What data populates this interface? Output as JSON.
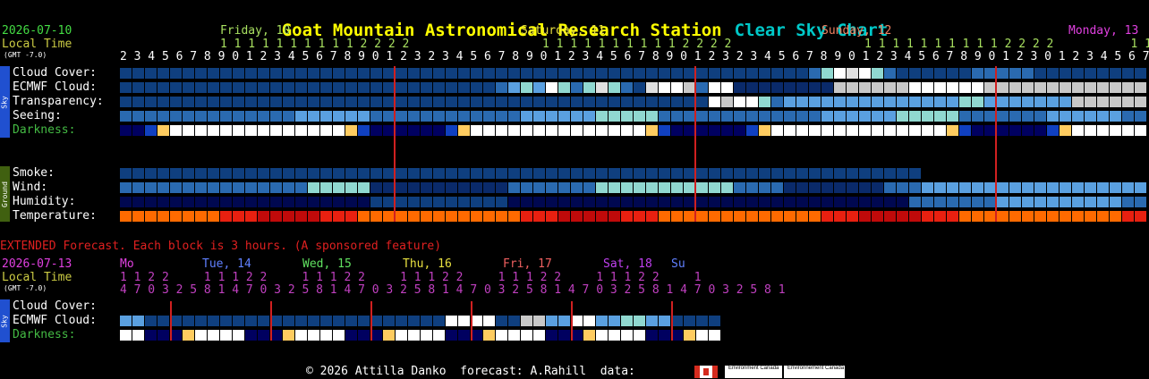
{
  "header": {
    "station": "Goat Mountain Astronomical Research Station",
    "chart_name": "Clear Sky Chart",
    "date": "2026-07-10",
    "local_time": "Local Time",
    "gmt_offset": "(GMT -7.0)"
  },
  "days": [
    {
      "label": "Friday, 10",
      "color": "#a8e060"
    },
    {
      "label": "Saturday, 11",
      "color": "#e8e040"
    },
    {
      "label": "Sunday, 12",
      "color": "#f08060"
    },
    {
      "label": "Monday, 13",
      "color": "#e040e0"
    }
  ],
  "hours_tens": " 1 1 1 1 1 1 1 1 1 1 2 2 2 2",
  "hours_units": "2 3 4 5 6 7 8 9 0 1 2 3 4 5 6 7 8 9 0 1 2 3",
  "monday_tens": "1 1",
  "monday_units": "0 1 2 3 4 5 6 7 8 9 0 1",
  "sky_rows": [
    {
      "label": "Cloud Cover:",
      "key": "cloud"
    },
    {
      "label": "ECMWF Cloud:",
      "key": "ecmwf"
    },
    {
      "label": "Transparency:",
      "key": "transp"
    },
    {
      "label": "Seeing:",
      "key": "seeing"
    },
    {
      "label": "Darkness:",
      "key": "dark"
    }
  ],
  "ground_rows": [
    {
      "label": "Smoke:",
      "key": "smoke"
    },
    {
      "label": "Wind:",
      "key": "wind"
    },
    {
      "label": "Humidity:",
      "key": "humid"
    },
    {
      "label": "Temperature:",
      "key": "temp"
    }
  ],
  "tabs": {
    "sky": "Sky",
    "ground": "Ground"
  },
  "extended": {
    "notice": "EXTENDED Forecast. Each block is 3 hours. (A sponsored feature)",
    "date": "2026-07-13",
    "local_time": "Local Time",
    "gmt_offset": "(GMT -7.0)",
    "days": [
      {
        "label": "Mo",
        "color": "#e040e0"
      },
      {
        "label": "Tue, 14",
        "color": "#6080ff"
      },
      {
        "label": "Wed, 15",
        "color": "#60e060"
      },
      {
        "label": "Thu, 16",
        "color": "#e8e040"
      },
      {
        "label": "Fri, 17",
        "color": "#f06060"
      },
      {
        "label": "Sat, 18",
        "color": "#c040f0"
      },
      {
        "label": "Su",
        "color": "#6080ff"
      }
    ],
    "hours_tens": "1 1 2 2     1 1 1 2 2     1 1 1 2 2     1 1 1 2 2     1 1 1 2 2     1 1 1 2 2     1",
    "hours_units": "4 7 0 3 2 5 8 1 4 7 0 3 2 5 8 1 4 7 0 3 2 5 8 1 4 7 0 3 2 5 8 1 4 7 0 3 2 5 8 1 4 7 0 3 2 5 8 1",
    "rows": [
      {
        "label": "Cloud Cover:",
        "key": "x_cloud"
      },
      {
        "label": "ECMWF Cloud:",
        "key": "x_ecmwf"
      },
      {
        "label": "Darkness:",
        "key": "x_dark"
      }
    ]
  },
  "footer": {
    "text": "© 2026 Attilla Danko  forecast: A.Rahill  data:",
    "flag1": "Environment Canada",
    "flag2": "Environnement Canada"
  },
  "colors": {
    "navy": "#0a2a6a",
    "dblue": "#0f3f7f",
    "mblue": "#2a6ab0",
    "lblue": "#5aa0e0",
    "cyan": "#90d8d0",
    "white": "#ffffff",
    "grey": "#c8c8c8",
    "lgrey": "#e0e0e0",
    "redline": "#d02020"
  }
}
